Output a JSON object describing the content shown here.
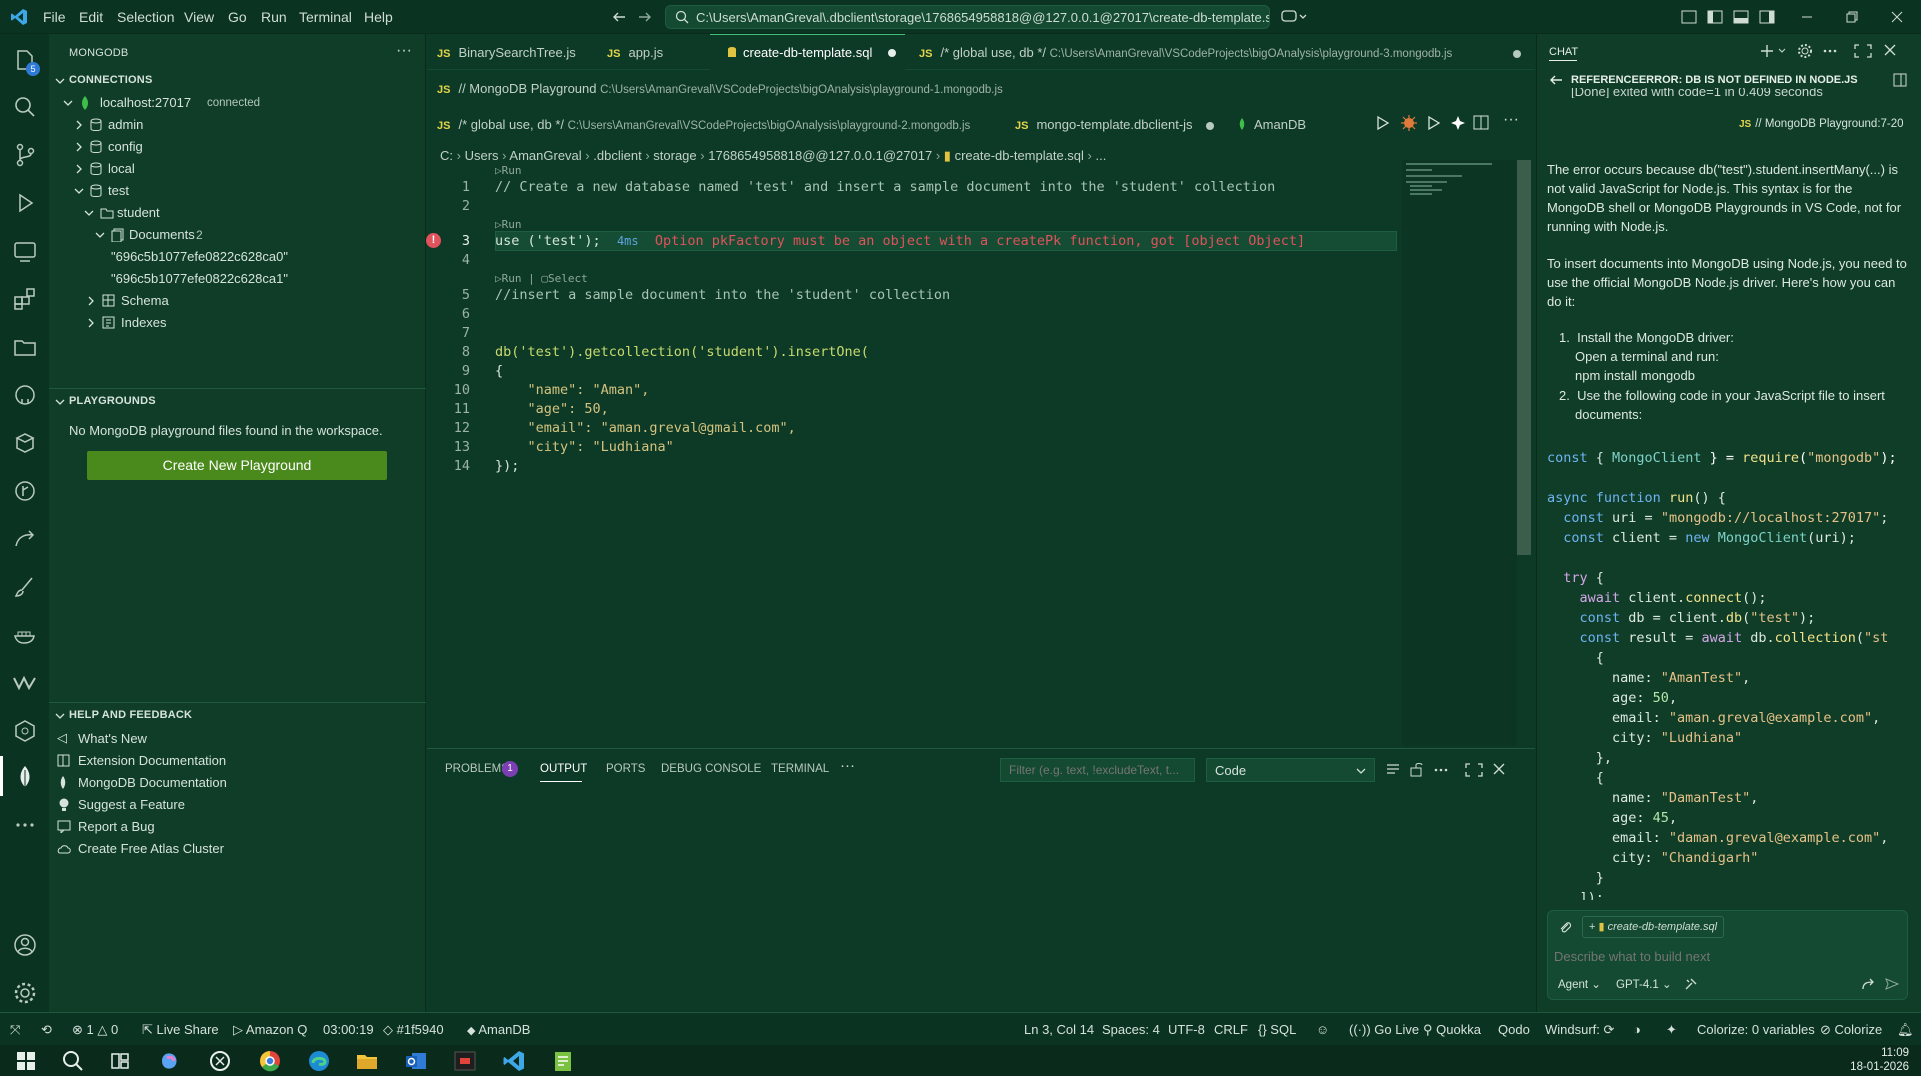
{
  "titlebar": {
    "menu": [
      "File",
      "Edit",
      "Selection",
      "View",
      "Go",
      "Run",
      "Terminal",
      "Help"
    ],
    "command_center": "C:\\Users\\AmanGreval\\.dbclient\\storage\\1768654958818@@127.0.0.1@27017\\create-db-template.sql - ..."
  },
  "activitybar": {
    "badge": "5"
  },
  "sidebar": {
    "title": "MONGODB",
    "connections_header": "CONNECTIONS",
    "connection_name": "localhost:27017",
    "connection_status": "connected",
    "databases": [
      "admin",
      "config",
      "local",
      "test"
    ],
    "collection": "student",
    "documents_label": "Documents",
    "documents_count": "2",
    "documents": [
      "\"696c5b1077efe0822c628ca0\"",
      "\"696c5b1077efe0822c628ca1\""
    ],
    "schema_label": "Schema",
    "indexes_label": "Indexes",
    "playgrounds_header": "PLAYGROUNDS",
    "playgrounds_empty": "No MongoDB playground files found in the workspace.",
    "create_playground": "Create New Playground",
    "help_header": "HELP AND FEEDBACK",
    "help_items": [
      "What's New",
      "Extension Documentation",
      "MongoDB Documentation",
      "Suggest a Feature",
      "Report a Bug",
      "Create Free Atlas Cluster"
    ]
  },
  "editor": {
    "tabs_row1": [
      {
        "name": "BinarySearchTree.js"
      },
      {
        "name": "app.js"
      },
      {
        "name": "create-db-template.sql"
      },
      {
        "name": "/* global use, db */",
        "path": "C:\\Users\\AmanGreval\\VSCodeProjects\\bigOAnalysis\\playground-3.mongodb.js"
      }
    ],
    "tabs_row2": [
      {
        "name": "// MongoDB Playground",
        "path": "C:\\Users\\AmanGreval\\VSCodeProjects\\bigOAnalysis\\playground-1.mongodb.js"
      }
    ],
    "tabs_row3": [
      {
        "name": "/* global use, db */",
        "path": "C:\\Users\\AmanGreval\\VSCodeProjects\\bigOAnalysis\\playground-2.mongodb.js"
      },
      {
        "name": "mongo-template.dbclient-js"
      },
      {
        "name": "AmanDB"
      }
    ],
    "breadcrumb": [
      "C:",
      "Users",
      "AmanGreval",
      ".dbclient",
      "storage",
      "1768654958818@@127.0.0.1@27017",
      "create-db-template.sql",
      "..."
    ],
    "codelens_run": "Run",
    "codelens_select": "Select",
    "codelens_sep": "|",
    "lines": {
      "l1": "// Create a new database named 'test' and insert a sample document into the 'student' collection",
      "l3_code": "use ('test');",
      "l3_time": "4ms",
      "l3_error": "Option pkFactory must be an object with a createPk function, got [object Object]",
      "l5": "//insert a sample document into the 'student' collection",
      "l8": "db('test').getcollection('student').insertOne(",
      "l9": "{",
      "l10": "    \"name\": \"Aman\",",
      "l11": "    \"age\": 50,",
      "l12": "    \"email\": \"aman.greval@gmail.com\",",
      "l13": "    \"city\": \"Ludhiana\"",
      "l14": "});"
    },
    "line_numbers": [
      "1",
      "2",
      "3",
      "4",
      "5",
      "6",
      "7",
      "8",
      "9",
      "10",
      "11",
      "12",
      "13",
      "14"
    ]
  },
  "panel": {
    "tabs": [
      "PROBLEMS",
      "OUTPUT",
      "PORTS",
      "DEBUG CONSOLE",
      "TERMINAL"
    ],
    "problems_count": "1",
    "filter_placeholder": "Filter (e.g. text, !excludeText, t...",
    "dropdown_value": "Code"
  },
  "chat": {
    "title": "CHAT",
    "thread_title": "REFERENCEERROR: DB IS NOT DEFINED IN NODE.JS",
    "partial_line": "[Done] exited with code=1 in 0.409 seconds",
    "ref_chip": "// MongoDB Playground:7-20",
    "p1": "The error occurs because db(\"test\").student.insertMany(...) is not valid JavaScript for Node.js. This syntax is for the MongoDB shell or MongoDB Playgrounds in VS Code, not for running with Node.js.",
    "p2": "To insert documents into MongoDB using Node.js, you need to use the official MongoDB Node.js driver. Here's how you can do it:",
    "step1": "Install the MongoDB driver:",
    "step1a": "Open a terminal and run:",
    "step1b": "npm install mongodb",
    "step2": "Use the following code in your JavaScript file to insert documents:",
    "code": [
      "const { MongoClient } = require(\"mongodb\");",
      "",
      "async function run() {",
      "  const uri = \"mongodb://localhost:27017\";",
      "  const client = new MongoClient(uri);",
      "",
      "  try {",
      "    await client.connect();",
      "    const db = client.db(\"test\");",
      "    const result = await db.collection(\"st",
      "      {",
      "        name: \"AmanTest\",",
      "        age: 50,",
      "        email: \"aman.greval@example.com\",",
      "        city: \"Ludhiana\"",
      "      },",
      "      {",
      "        name: \"DamanTest\",",
      "        age: 45,",
      "        email: \"daman.greval@example.com\",",
      "        city: \"Chandigarh\"",
      "      }",
      "    ]);"
    ],
    "attachment": "create-db-template.sql",
    "input_placeholder": "Describe what to build next",
    "agent_label": "Agent",
    "model_label": "GPT-4.1"
  },
  "statusbar": {
    "errors": "1",
    "warnings": "0",
    "live_share": "Live Share",
    "amazon_q": "Amazon Q",
    "timer": "03:00:19",
    "color": "#1f5940",
    "db": "AmanDB",
    "position": "Ln 3, Col 14",
    "spaces": "Spaces: 4",
    "encoding": "UTF-8",
    "eol": "CRLF",
    "language": "SQL",
    "go_live": "Go Live",
    "quokka": "Quokka",
    "qodo": "Qodo",
    "windsurf": "Windsurf:",
    "colorize_vars": "Colorize: 0 variables",
    "colorize": "Colorize"
  },
  "taskbar": {
    "time": "11:09",
    "date": "18-01-2026"
  },
  "colors": {
    "bg": "#0d3a26",
    "accent": "#4a8a1c",
    "error": "#e0525c"
  }
}
